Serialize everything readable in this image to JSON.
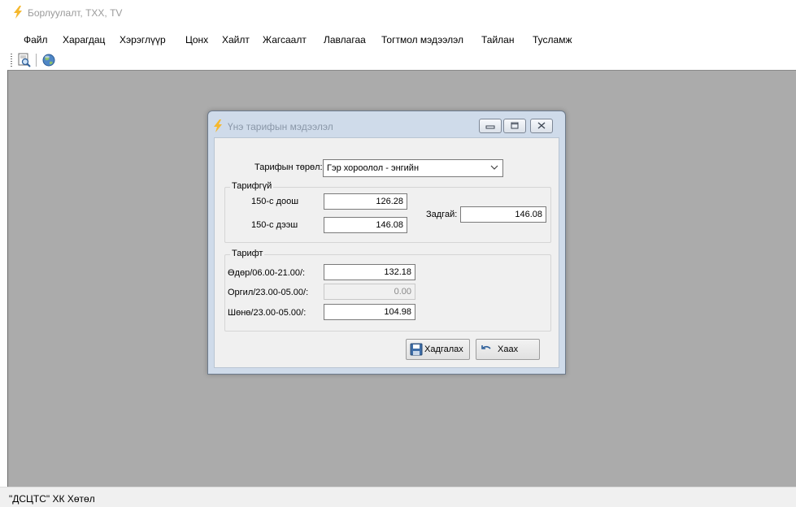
{
  "app": {
    "title": "Борлуулалт, ТХХ, TV",
    "icon": "lightning-bolt-icon"
  },
  "menubar": {
    "items": [
      "Файл",
      "Харагдац",
      "Хэрэглүүр",
      "Цонх",
      "Хайлт",
      "Жагсаалт",
      "Лавлагаа",
      "Тогтмол мэдээлэл",
      "Тайлан",
      "Тусламж"
    ]
  },
  "toolbar": {
    "icons": [
      "print-preview-icon",
      "globe-icon"
    ]
  },
  "dialog": {
    "title": "Үнэ тарифын мэдээлэл",
    "icon": "lightning-bolt-icon",
    "tariff_type_label": "Тарифын төрөл:",
    "tariff_type_value": "Гэр хороолол - энгийн",
    "untariffed": {
      "group_title": "Тарифгүй",
      "below150_label": "150-с доош",
      "below150_value": "126.28",
      "above150_label": "150-с дээш",
      "above150_value": "146.08",
      "retail_label": "Задгай:",
      "retail_value": "146.08"
    },
    "tariffed": {
      "group_title": "Тарифт",
      "day_label": "Өдөр/06.00-21.00/:",
      "day_value": "132.18",
      "evening_label": "Оргил/23.00-05.00/:",
      "evening_value": "0.00",
      "night_label": "Шөнө/23.00-05.00/:",
      "night_value": "104.98"
    },
    "save_label": "Хадгалах",
    "close_label": "Хаах"
  },
  "statusbar": {
    "text": "\"ДСЦТС\" ХК Хөтөл"
  },
  "colors": {
    "mdi_background": "#ababab",
    "dialog_frame": "#cfdbea",
    "icon_accent": "#f5b82e"
  }
}
